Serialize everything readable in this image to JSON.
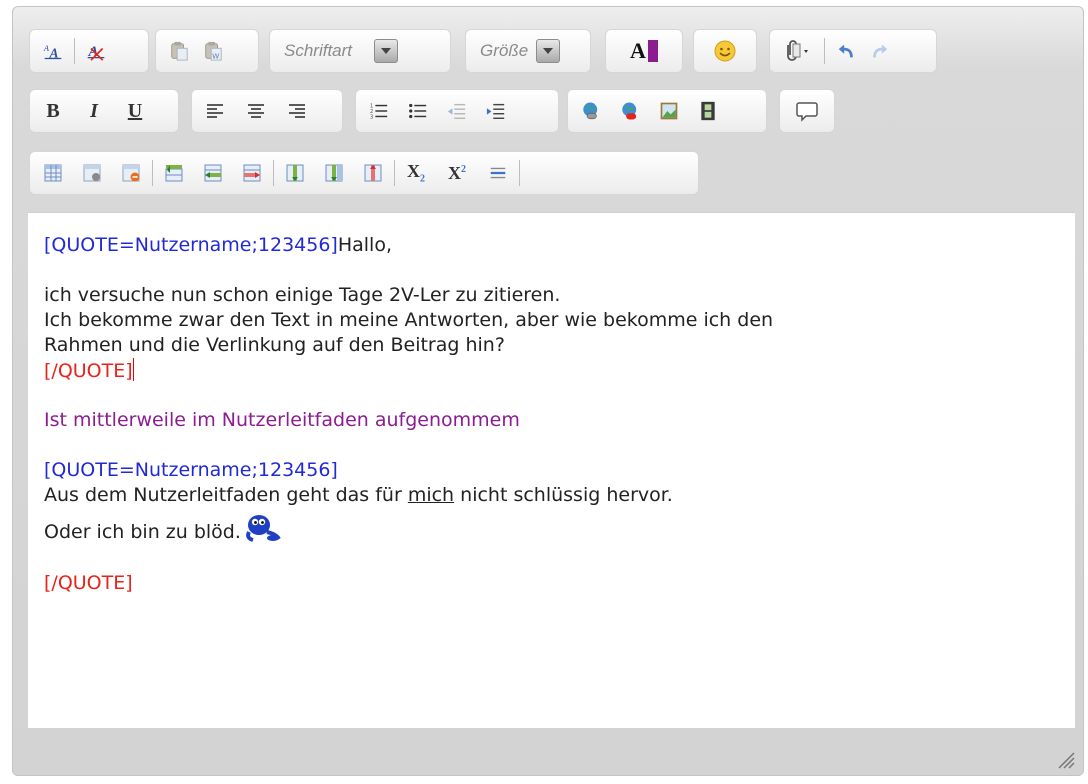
{
  "toolbar": {
    "font_label": "Schriftart",
    "size_label": "Größe",
    "text_color_glyph": "A",
    "bold_glyph": "B",
    "italic_glyph": "I",
    "underline_glyph": "U",
    "subscript_glyph": "X",
    "subscript_sub": "2",
    "superscript_glyph": "X",
    "superscript_sup": "2",
    "highlight_color": "#8b1d91"
  },
  "icons": [
    "font-size-icon",
    "remove-format-icon",
    "paste-icon",
    "paste-word-icon",
    "font-color-icon",
    "smiley-icon",
    "attachment-icon",
    "undo-icon",
    "redo-icon",
    "align-left-icon",
    "align-center-icon",
    "align-right-icon",
    "ordered-list-icon",
    "unordered-list-icon",
    "outdent-icon",
    "indent-icon",
    "insert-link-icon",
    "remove-link-icon",
    "insert-image-icon",
    "insert-video-icon",
    "quote-icon",
    "table-icon",
    "table-properties-icon",
    "delete-table-icon",
    "insert-row-above-icon",
    "insert-row-below-icon",
    "delete-row-icon",
    "insert-column-left-icon",
    "insert-column-right-icon",
    "delete-column-icon",
    "horizontal-rule-icon",
    "resize-grip-icon"
  ],
  "editor": {
    "quote1_open": "[QUOTE=Nutzername;123456]",
    "quote1_first": "Hallo,",
    "para1": "ich versuche nun schon einige Tage 2V-Ler zu zitieren.",
    "para2": "Ich bekomme zwar den Text in meine Antworten, aber wie bekomme ich den",
    "para3": "Rahmen und die Verlinkung auf den Beitrag hin?",
    "quote1_close": "[/QUOTE]",
    "reply": "Ist mittlerweile im Nutzerleitfaden aufgenommem",
    "quote2_open": "[QUOTE=Nutzername;123456]",
    "para4_a": "Aus dem Nutzerleitfaden geht das für ",
    "para4_u": "mich",
    "para4_b": " nicht schlüssig hervor.",
    "para5": "Oder ich bin zu blöd.",
    "quote2_close": "[/QUOTE]"
  },
  "colors": {
    "quote_open": "#2229d6",
    "quote_close": "#e8231b",
    "reply_text": "#8b1d91"
  }
}
